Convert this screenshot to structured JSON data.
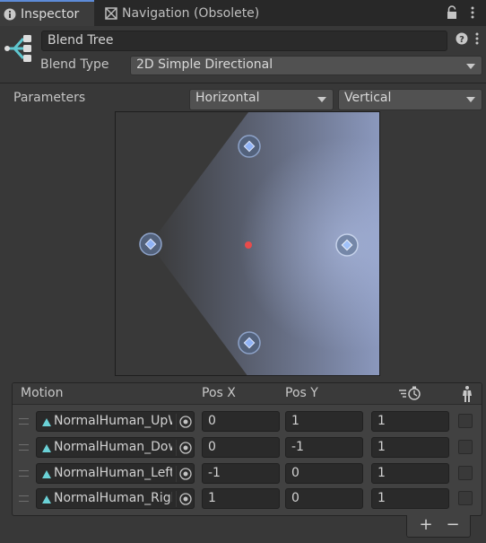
{
  "tabs": [
    {
      "label": "Inspector",
      "icon": "info-icon",
      "active": true
    },
    {
      "label": "Navigation (Obsolete)",
      "icon": "navigation-icon",
      "active": false
    }
  ],
  "header": {
    "name": "Blend Tree",
    "blend_type_label": "Blend Type",
    "blend_type_value": "2D Simple Directional"
  },
  "parameters": {
    "label": "Parameters",
    "horizontal": "Horizontal",
    "vertical": "Vertical"
  },
  "motion_table": {
    "headers": {
      "motion": "Motion",
      "pos_x": "Pos X",
      "pos_y": "Pos Y",
      "speed_icon": "speed-icon",
      "mirror_icon": "mirror-icon"
    },
    "rows": [
      {
        "motion": "NormalHuman_UpW",
        "pos_x": "0",
        "pos_y": "1",
        "speed": "1"
      },
      {
        "motion": "NormalHuman_DownW",
        "pos_x": "0",
        "pos_y": "-1",
        "speed": "1"
      },
      {
        "motion": "NormalHuman_LeftW",
        "pos_x": "-1",
        "pos_y": "0",
        "speed": "1"
      },
      {
        "motion": "NormalHuman_RightW",
        "pos_x": "1",
        "pos_y": "0",
        "speed": "1"
      }
    ]
  },
  "footer": {
    "add": "+",
    "remove": "−"
  },
  "colors": {
    "accent": "#5d8bd8",
    "point": "#7fa6ea",
    "current": "#e84b4b"
  }
}
